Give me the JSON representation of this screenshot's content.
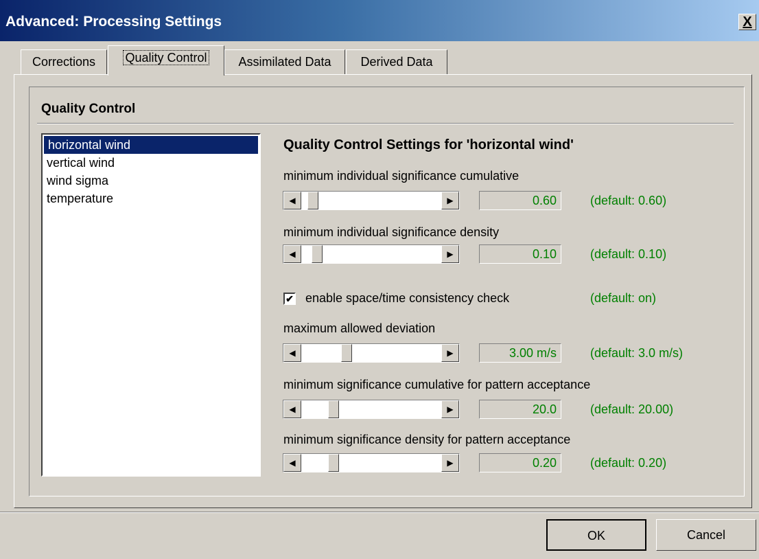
{
  "window": {
    "title": "Advanced: Processing Settings",
    "close_label": "X"
  },
  "tabs": [
    {
      "label": "Corrections"
    },
    {
      "label": "Quality Control"
    },
    {
      "label": "Assimilated Data"
    },
    {
      "label": "Derived Data"
    }
  ],
  "group": {
    "title": "Quality Control"
  },
  "list": {
    "items": [
      "horizontal wind",
      "vertical wind",
      "wind sigma",
      "temperature"
    ],
    "selected": "horizontal wind"
  },
  "settings": {
    "title": "Quality Control Settings for 'horizontal wind'",
    "rows": [
      {
        "label": "minimum individual significance cumulative",
        "value": "0.60",
        "default": "(default: 0.60)",
        "slider_fraction": 0.05
      },
      {
        "label": "minimum individual significance density",
        "value": "0.10",
        "default": "(default: 0.10)",
        "slider_fraction": 0.08
      },
      {
        "label": "maximum allowed deviation",
        "value": "3.00 m/s",
        "default": "(default: 3.0 m/s)",
        "slider_fraction": 0.31
      },
      {
        "label": "minimum significance cumulative for pattern acceptance",
        "value": "20.0",
        "default": "(default: 20.00)",
        "slider_fraction": 0.21
      },
      {
        "label": "minimum significance density for pattern acceptance",
        "value": "0.20",
        "default": "(default: 0.20)",
        "slider_fraction": 0.21
      }
    ],
    "consistency": {
      "label": "enable space/time consistency check",
      "checked": true,
      "check_glyph": "✔",
      "default": "(default: on)"
    }
  },
  "buttons": {
    "ok": "OK",
    "cancel": "Cancel"
  },
  "icons": {
    "left_arrow": "◀",
    "right_arrow": "▶"
  }
}
